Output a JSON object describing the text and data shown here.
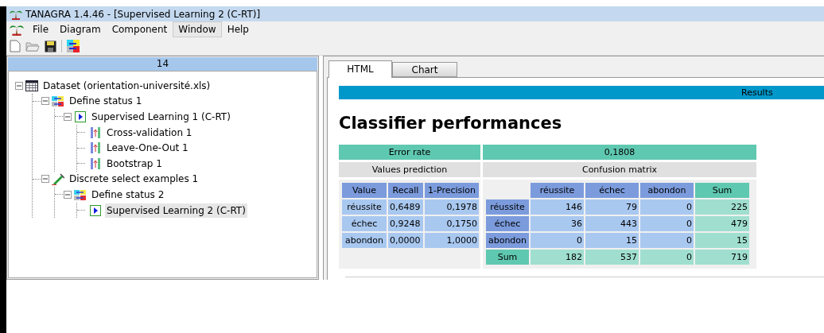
{
  "window": {
    "title": "TANAGRA 1.4.46 - [Supervised Learning 2 (C-RT)]"
  },
  "menu": [
    {
      "label": "File",
      "highlighted": false
    },
    {
      "label": "Diagram",
      "highlighted": false
    },
    {
      "label": "Component",
      "highlighted": false
    },
    {
      "label": "Window",
      "highlighted": true
    },
    {
      "label": "Help",
      "highlighted": false
    }
  ],
  "tree": {
    "header": "14",
    "nodes": [
      {
        "label": "Dataset (orientation-université.xls)",
        "kind": "dataset",
        "selected": false,
        "expanded": true,
        "children": [
          {
            "label": "Define status 1",
            "kind": "status",
            "selected": false,
            "expanded": true,
            "children": [
              {
                "label": "Supervised Learning 1 (C-RT)",
                "kind": "learning",
                "selected": false,
                "expanded": true,
                "children": [
                  {
                    "label": "Cross-validation 1",
                    "kind": "validation",
                    "selected": false
                  },
                  {
                    "label": "Leave-One-Out 1",
                    "kind": "validation",
                    "selected": false
                  },
                  {
                    "label": "Bootstrap 1",
                    "kind": "validation",
                    "selected": false
                  }
                ]
              }
            ]
          },
          {
            "label": "Discrete select examples 1",
            "kind": "select",
            "selected": false,
            "expanded": true,
            "children": [
              {
                "label": "Define status 2",
                "kind": "status",
                "selected": false,
                "expanded": true,
                "children": [
                  {
                    "label": "Supervised Learning 2 (C-RT)",
                    "kind": "learning",
                    "selected": true
                  }
                ]
              }
            ]
          }
        ]
      }
    ]
  },
  "tabs": [
    {
      "label": "HTML",
      "selected": true
    },
    {
      "label": "Chart",
      "selected": false
    }
  ],
  "results": {
    "banner": "Results",
    "heading": "Classifier performances",
    "error_rate_label": "Error rate",
    "error_rate": "0,1808",
    "values_prediction_title": "Values prediction",
    "confusion_matrix_title": "Confusion matrix",
    "values_prediction": {
      "columns": [
        "Value",
        "Recall",
        "1-Precision"
      ],
      "rows": [
        [
          "réussite",
          "0,6489",
          "0,1978"
        ],
        [
          "échec",
          "0,9248",
          "0,1750"
        ],
        [
          "abondon",
          "0,0000",
          "1,0000"
        ]
      ]
    },
    "confusion_matrix": {
      "columns": [
        "réussite",
        "échec",
        "abondon",
        "Sum"
      ],
      "rows": [
        {
          "label": "réussite",
          "kind": "class",
          "cells": [
            "146",
            "79",
            "0",
            "225"
          ]
        },
        {
          "label": "échec",
          "kind": "class",
          "cells": [
            "36",
            "443",
            "0",
            "479"
          ]
        },
        {
          "label": "abondon",
          "kind": "class",
          "cells": [
            "0",
            "15",
            "0",
            "15"
          ]
        },
        {
          "label": "Sum",
          "kind": "sum",
          "cells": [
            "182",
            "537",
            "0",
            "719"
          ]
        }
      ]
    }
  }
}
